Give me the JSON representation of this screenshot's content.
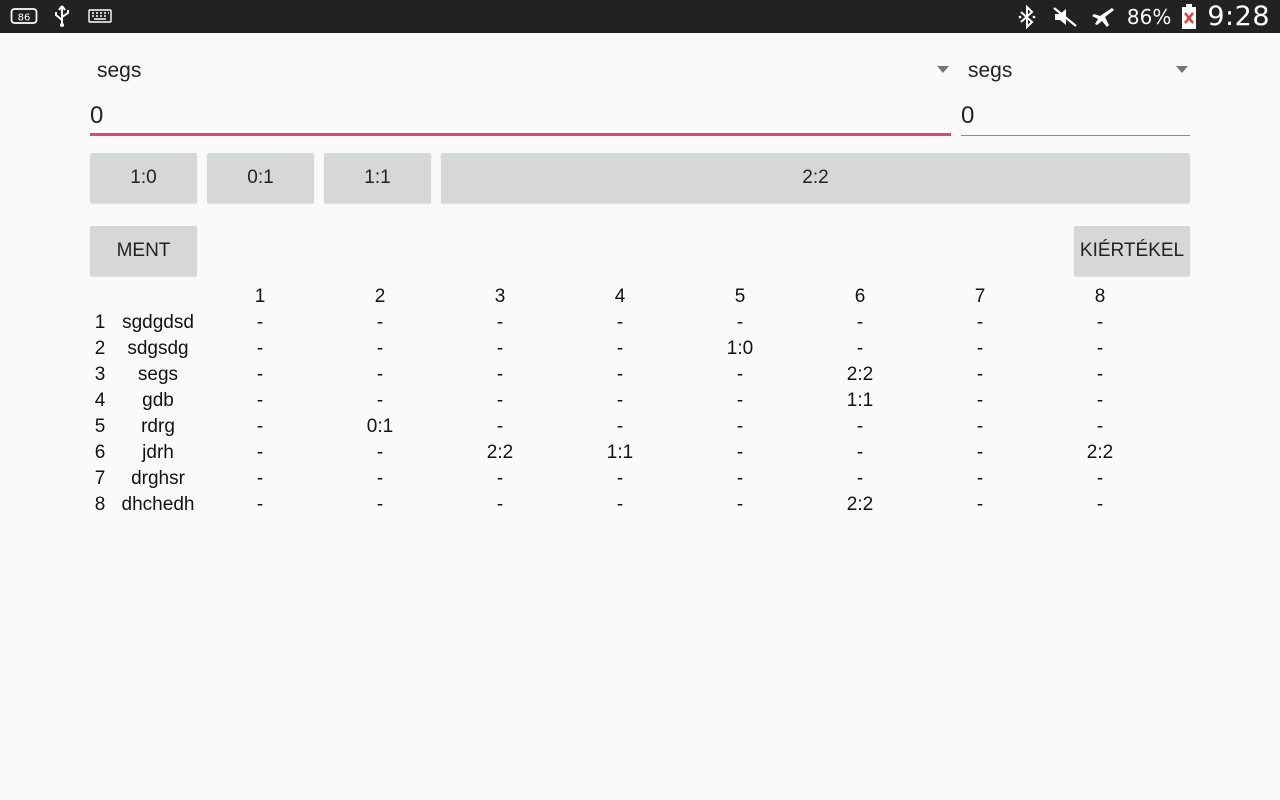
{
  "status_bar": {
    "left_icons": [
      "iso-badge-icon",
      "usb-icon",
      "keyboard-icon"
    ],
    "right_icons": [
      "bluetooth-icon",
      "mute-icon",
      "airplane-mode-icon",
      "battery-icon"
    ],
    "battery_percent": "86%",
    "time": "9:28"
  },
  "selectors": {
    "left": {
      "value": "segs"
    },
    "right": {
      "value": "segs"
    }
  },
  "scores": {
    "left": "0",
    "right": "0"
  },
  "result_buttons": [
    "1:0",
    "0:1",
    "1:1",
    "2:2"
  ],
  "actions": {
    "save_label": "MENT",
    "evaluate_label": "KIÉRTÉKEL"
  },
  "table": {
    "columns": [
      "1",
      "2",
      "3",
      "4",
      "5",
      "6",
      "7",
      "8"
    ],
    "rows": [
      {
        "index": "1",
        "name": "sgdgdsd",
        "cells": [
          "-",
          "-",
          "-",
          "-",
          "-",
          "-",
          "-",
          "-"
        ]
      },
      {
        "index": "2",
        "name": "sdgsdg",
        "cells": [
          "-",
          "-",
          "-",
          "-",
          "1:0",
          "-",
          "-",
          "-"
        ]
      },
      {
        "index": "3",
        "name": "segs",
        "cells": [
          "-",
          "-",
          "-",
          "-",
          "-",
          "2:2",
          "-",
          "-"
        ]
      },
      {
        "index": "4",
        "name": "gdb",
        "cells": [
          "-",
          "-",
          "-",
          "-",
          "-",
          "1:1",
          "-",
          "-"
        ]
      },
      {
        "index": "5",
        "name": "rdrg",
        "cells": [
          "-",
          "0:1",
          "-",
          "-",
          "-",
          "-",
          "-",
          "-"
        ]
      },
      {
        "index": "6",
        "name": "jdrh",
        "cells": [
          "-",
          "-",
          "2:2",
          "1:1",
          "-",
          "-",
          "-",
          "2:2"
        ]
      },
      {
        "index": "7",
        "name": "drghsr",
        "cells": [
          "-",
          "-",
          "-",
          "-",
          "-",
          "-",
          "-",
          "-"
        ]
      },
      {
        "index": "8",
        "name": "dhchedh",
        "cells": [
          "-",
          "-",
          "-",
          "-",
          "-",
          "2:2",
          "-",
          "-"
        ]
      }
    ]
  },
  "colors": {
    "status_bar": "#222222",
    "background": "#fafafa",
    "accent_underline": "#e0457b",
    "button": "#d6d7d7"
  }
}
